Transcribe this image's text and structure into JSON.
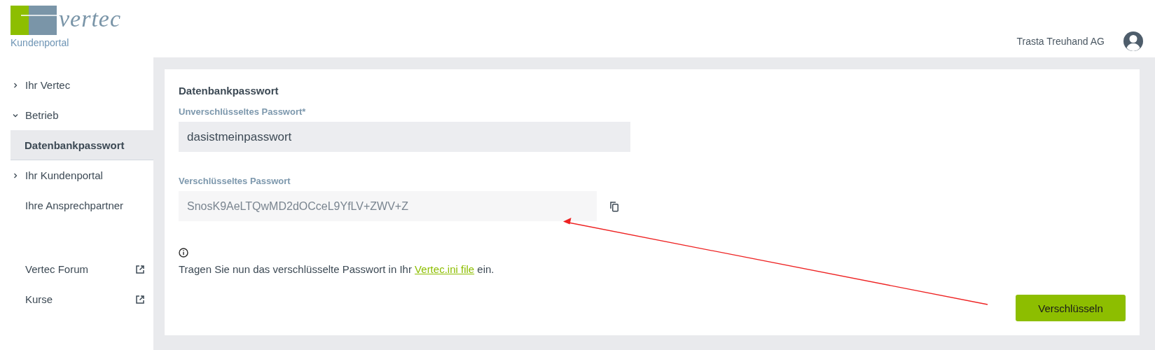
{
  "header": {
    "logo_text": "vertec",
    "portal_label": "Kundenportal",
    "company": "Trasta Treuhand AG"
  },
  "sidebar": {
    "items": [
      {
        "kind": "group",
        "label": "Ihr Vertec",
        "expanded": false
      },
      {
        "kind": "group",
        "label": "Betrieb",
        "expanded": true,
        "children": [
          {
            "kind": "link",
            "label": "Datenbankpasswort",
            "selected": true
          }
        ]
      },
      {
        "kind": "group",
        "label": "Ihr Kundenportal",
        "expanded": false
      },
      {
        "kind": "link",
        "label": "Ihre Ansprechpartner",
        "selected": false
      },
      {
        "kind": "spacer"
      },
      {
        "kind": "external",
        "label": "Vertec Forum"
      },
      {
        "kind": "external",
        "label": "Kurse"
      }
    ]
  },
  "form": {
    "title": "Datenbankpasswort",
    "plain_label": "Unverschlüsseltes Passwort*",
    "plain_value": "dasistmeinpasswort",
    "encrypted_label": "Verschlüsseltes Passwort",
    "encrypted_value": "SnosK9AeLTQwMD2dOCceL9YfLV+ZWV+Z",
    "hint_before": "Tragen Sie nun das verschlüsselte Passwort in Ihr ",
    "hint_link": "Vertec.ini file",
    "hint_after": " ein.",
    "submit": "Verschlüsseln"
  }
}
